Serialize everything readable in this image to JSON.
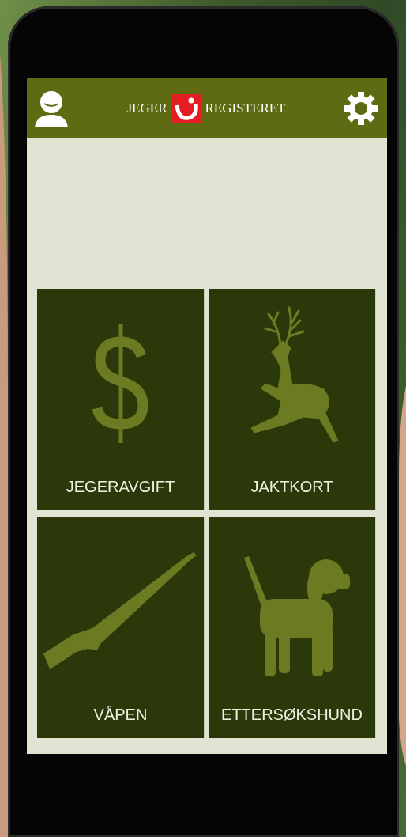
{
  "header": {
    "logo_left": "JEGER",
    "logo_right": "REGISTERET"
  },
  "tiles": [
    {
      "label": "JEGERAVGIFT",
      "kind": "dollar"
    },
    {
      "label": "JAKTKORT",
      "kind": "deer"
    },
    {
      "label": "VÅPEN",
      "kind": "rifle"
    },
    {
      "label": "ETTERSØKSHUND",
      "kind": "dog"
    }
  ]
}
